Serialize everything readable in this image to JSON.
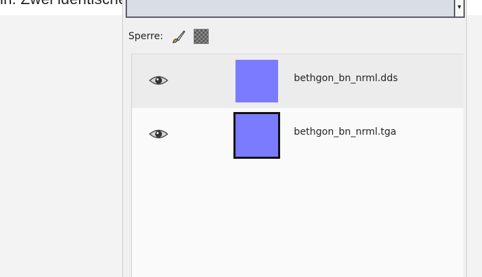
{
  "caption": {
    "text": "in. Zwei identische Ebenen. Die neue benennt ihr in statt in"
  },
  "layers_panel": {
    "combo_arrow": "▾",
    "lock": {
      "label": "Sperre:",
      "icons": [
        "paintbrush-icon",
        "alpha-checker-icon"
      ]
    },
    "layers": [
      {
        "name": "bethgon_bn_nrml.dds",
        "visible": true,
        "visibility_icon": "eye-icon",
        "thumbnail_color": "#7b7bff",
        "selected": false,
        "highlighted": true
      },
      {
        "name": "bethgon_bn_nrml.tga",
        "visible": true,
        "visibility_icon": "eye-icon",
        "thumbnail_color": "#7b7bff",
        "selected": true,
        "highlighted": false
      }
    ]
  },
  "colors": {
    "combo_fill": "#d9dde6",
    "row_highlight": "#ececec",
    "list_background": "#fafafa"
  }
}
